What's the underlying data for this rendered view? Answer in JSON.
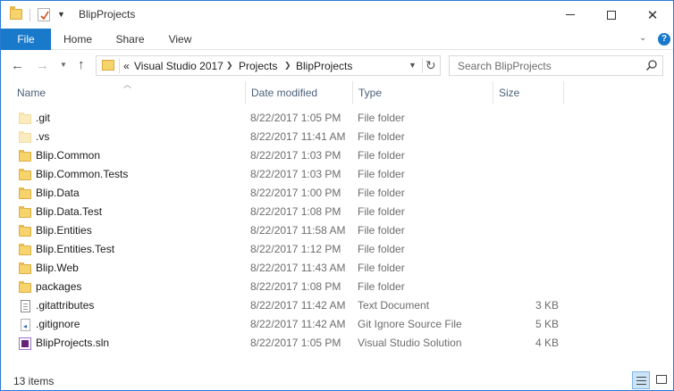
{
  "window": {
    "title": "BlipProjects",
    "close_glyph": "✕"
  },
  "ribbon": {
    "tabs": [
      {
        "label": "File"
      },
      {
        "label": "Home"
      },
      {
        "label": "Share"
      },
      {
        "label": "View"
      }
    ],
    "help_glyph": "?"
  },
  "address": {
    "overflow_glyph": "«",
    "crumbs": [
      "Visual Studio 2017",
      "Projects",
      "BlipProjects"
    ]
  },
  "search": {
    "placeholder": "Search BlipProjects"
  },
  "columns": {
    "name": "Name",
    "date": "Date modified",
    "type": "Type",
    "size": "Size"
  },
  "files": [
    {
      "name": ".git",
      "date": "8/22/2017 1:05 PM",
      "type": "File folder",
      "size": "",
      "icon": "hidden-folder-icon"
    },
    {
      "name": ".vs",
      "date": "8/22/2017 11:41 AM",
      "type": "File folder",
      "size": "",
      "icon": "hidden-folder-icon"
    },
    {
      "name": "Blip.Common",
      "date": "8/22/2017 1:03 PM",
      "type": "File folder",
      "size": "",
      "icon": "folder-icon"
    },
    {
      "name": "Blip.Common.Tests",
      "date": "8/22/2017 1:03 PM",
      "type": "File folder",
      "size": "",
      "icon": "folder-icon"
    },
    {
      "name": "Blip.Data",
      "date": "8/22/2017 1:00 PM",
      "type": "File folder",
      "size": "",
      "icon": "folder-icon"
    },
    {
      "name": "Blip.Data.Test",
      "date": "8/22/2017 1:08 PM",
      "type": "File folder",
      "size": "",
      "icon": "folder-icon"
    },
    {
      "name": "Blip.Entities",
      "date": "8/22/2017 11:58 AM",
      "type": "File folder",
      "size": "",
      "icon": "folder-icon"
    },
    {
      "name": "Blip.Entities.Test",
      "date": "8/22/2017 1:12 PM",
      "type": "File folder",
      "size": "",
      "icon": "folder-icon"
    },
    {
      "name": "Blip.Web",
      "date": "8/22/2017 11:43 AM",
      "type": "File folder",
      "size": "",
      "icon": "folder-icon"
    },
    {
      "name": "packages",
      "date": "8/22/2017 1:08 PM",
      "type": "File folder",
      "size": "",
      "icon": "folder-icon"
    },
    {
      "name": ".gitattributes",
      "date": "8/22/2017 11:42 AM",
      "type": "Text Document",
      "size": "3 KB",
      "icon": "text-document-icon"
    },
    {
      "name": ".gitignore",
      "date": "8/22/2017 11:42 AM",
      "type": "Git Ignore Source File",
      "size": "5 KB",
      "icon": "vs-source-file-icon"
    },
    {
      "name": "BlipProjects.sln",
      "date": "8/22/2017 1:05 PM",
      "type": "Visual Studio Solution",
      "size": "4 KB",
      "icon": "vs-solution-icon"
    }
  ],
  "status": {
    "item_count": "13 items"
  },
  "colors": {
    "accent": "#1979ca",
    "folder": "#f6d36b",
    "header_text": "#4c607a",
    "secondary_text": "#6d6d6d"
  }
}
